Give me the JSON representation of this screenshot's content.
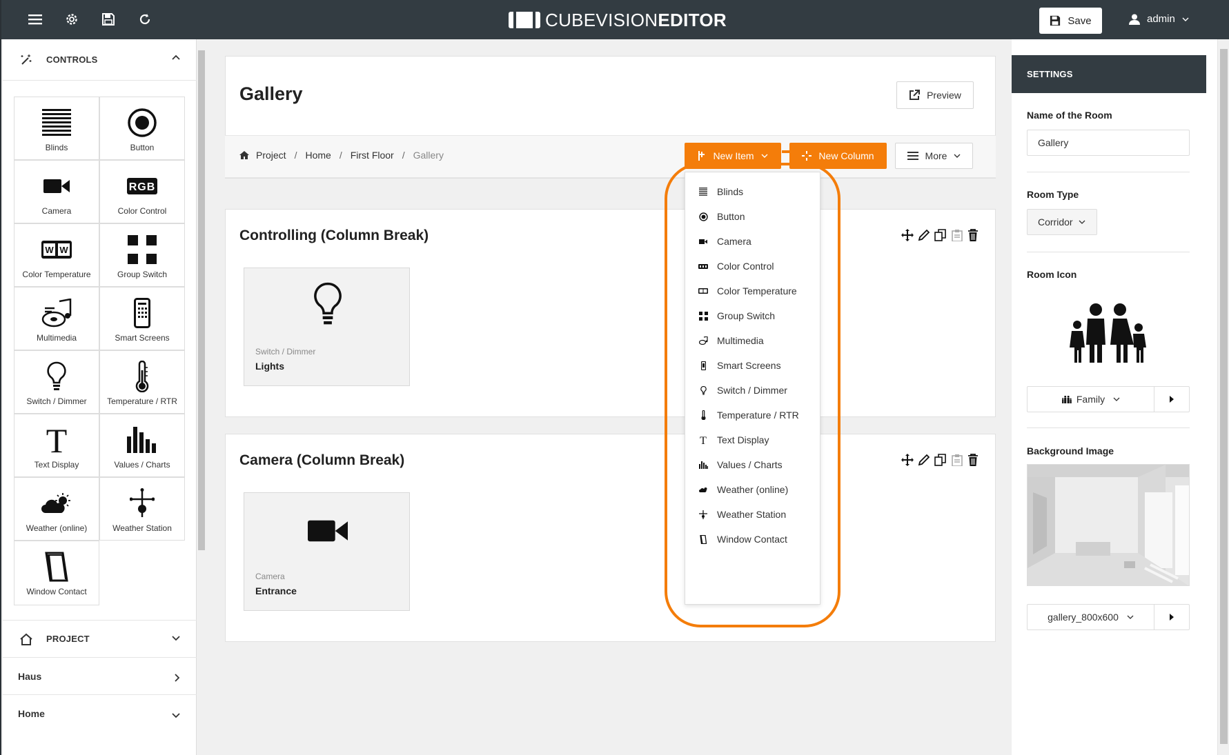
{
  "app": {
    "brand_light": "CUBEVISION",
    "brand_bold": "EDITOR"
  },
  "topbar": {
    "save_label": "Save",
    "user": "admin",
    "icons": [
      "menu-icon",
      "gear-icon",
      "floppy-icon",
      "refresh-icon"
    ]
  },
  "sidebar": {
    "controls_title": "CONTROLS",
    "tiles": [
      {
        "label": "Blinds",
        "icon": "blinds-icon"
      },
      {
        "label": "Button",
        "icon": "button-icon"
      },
      {
        "label": "Camera",
        "icon": "camera-icon"
      },
      {
        "label": "Color Control",
        "icon": "rgb-icon"
      },
      {
        "label": "Color Temperature",
        "icon": "color-temperature-icon"
      },
      {
        "label": "Group Switch",
        "icon": "group-switch-icon"
      },
      {
        "label": "Multimedia",
        "icon": "multimedia-icon"
      },
      {
        "label": "Smart Screens",
        "icon": "smart-screen-icon"
      },
      {
        "label": "Switch / Dimmer",
        "icon": "bulb-icon"
      },
      {
        "label": "Temperature / RTR",
        "icon": "thermometer-icon"
      },
      {
        "label": "Text Display",
        "icon": "text-icon"
      },
      {
        "label": "Values / Charts",
        "icon": "bar-chart-icon"
      },
      {
        "label": "Weather (online)",
        "icon": "weather-icon"
      },
      {
        "label": "Weather Station",
        "icon": "weather-station-icon"
      },
      {
        "label": "Window Contact",
        "icon": "window-contact-icon"
      }
    ],
    "project_title": "PROJECT",
    "nav": [
      {
        "label": "Haus"
      },
      {
        "label": "Home"
      }
    ]
  },
  "room": {
    "title": "Gallery",
    "preview_label": "Preview",
    "breadcrumb": [
      "Project",
      "Home",
      "First Floor",
      "Gallery"
    ],
    "new_item_label": "New Item",
    "new_column_label": "New Column",
    "more_label": "More"
  },
  "sections": [
    {
      "title": "Controlling (Column Break)",
      "item": {
        "type": "Switch / Dimmer",
        "name": "Lights"
      }
    },
    {
      "title": "Camera (Column Break)",
      "item": {
        "type": "Camera",
        "name": "Entrance"
      }
    }
  ],
  "dropdown": {
    "items": [
      "Blinds",
      "Button",
      "Camera",
      "Color Control",
      "Color Temperature",
      "Group Switch",
      "Multimedia",
      "Smart Screens",
      "Switch / Dimmer",
      "Temperature / RTR",
      "Text Display",
      "Values / Charts",
      "Weather (online)",
      "Weather Station",
      "Window Contact"
    ]
  },
  "settings": {
    "title": "SETTINGS",
    "name_label": "Name of the Room",
    "name_value": "Gallery",
    "type_label": "Room Type",
    "type_value": "Corridor",
    "icon_label": "Room Icon",
    "icon_value": "Family",
    "bg_label": "Background Image",
    "bg_value": "gallery_800x600"
  },
  "colors": {
    "accent": "#f47d0a",
    "topbar": "#333c42"
  }
}
